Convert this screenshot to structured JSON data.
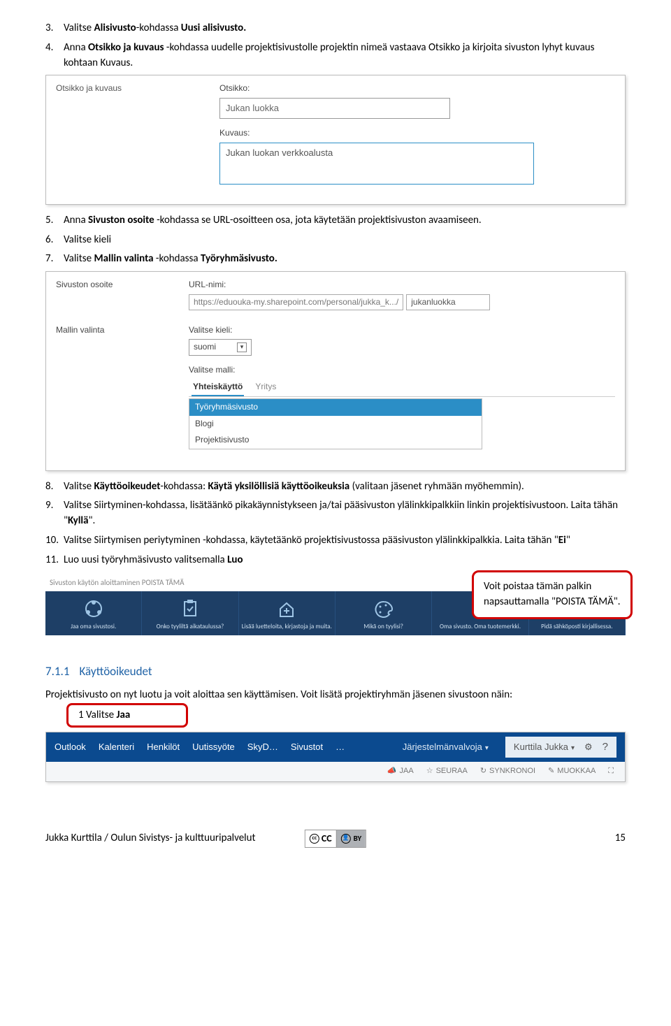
{
  "steps": {
    "s3": {
      "num": "3.",
      "p1": "Valitse ",
      "b1": "Alisivusto",
      "p2": "-kohdassa ",
      "b2": "Uusi alisivusto."
    },
    "s4": {
      "num": "4.",
      "p1": "Anna ",
      "b1": "Otsikko ja kuvaus",
      "p2": " -kohdassa uudelle projektisivustolle projektin nimeä vastaava Otsikko ja kirjoita sivuston lyhyt kuvaus kohtaan Kuvaus."
    },
    "s5": {
      "num": "5.",
      "p1": "Anna ",
      "b1": "Sivuston osoite",
      "p2": " -kohdassa se URL-osoitteen osa, jota käytetään projektisivuston avaamiseen."
    },
    "s6": {
      "num": "6.",
      "p1": "Valitse kieli"
    },
    "s7": {
      "num": "7.",
      "p1": "Valitse ",
      "b1": "Mallin valinta",
      "p2": " -kohdassa ",
      "b2": "Työryhmäsivusto."
    },
    "s8": {
      "num": "8.",
      "p1": "Valitse ",
      "b1": "Käyttöoikeudet",
      "p2": "-kohdassa: ",
      "b2": "Käytä yksilöllisiä käyttöoikeuksia",
      "p3": " (valitaan jäsenet ryhmään myöhemmin)."
    },
    "s9": {
      "num": "9.",
      "p1": "Valitse Siirtyminen-kohdassa, lisätäänkö pikakäynnistykseen ja/tai pääsivuston ylälinkkipalkkiin linkin projektisivustoon. Laita tähän \"",
      "b1": "Kyllä",
      "p2": "\"."
    },
    "s10": {
      "num": "10.",
      "p1": "Valitse Siirtymisen periytyminen -kohdassa, käytetäänkö projektisivustossa pääsivuston ylälinkkipalkkia. Laita tähän \"",
      "b1": "Ei",
      "p2": "\""
    },
    "s11": {
      "num": "11.",
      "p1": "Luo uusi työryhmäsivusto valitsemalla ",
      "b1": "Luo"
    }
  },
  "sc1": {
    "panel_label": "Otsikko ja kuvaus",
    "otsikko_label": "Otsikko:",
    "otsikko_value": "Jukan luokka",
    "kuvaus_label": "Kuvaus:",
    "kuvaus_value": "Jukan luokan verkkoalusta"
  },
  "sc2": {
    "site_label": "Sivuston osoite",
    "url_label": "URL-nimi:",
    "url_prefix": "https://eduouka-my.sharepoint.com/personal/jukka_k.../",
    "url_value": "jukanluokka",
    "template_label": "Mallin valinta",
    "lang_label": "Valitse kieli:",
    "lang_value": "suomi",
    "tmpl_label": "Valitse malli:",
    "tab1": "Yhteiskäyttö",
    "tab2": "Yritys",
    "t1": "Työryhmäsivusto",
    "t2": "Blogi",
    "t3": "Projektisivusto"
  },
  "tilebar": {
    "header": "Sivuston käytön aloittaminen    POISTA TÄMÄ",
    "tiles": [
      {
        "label": "Jaa oma sivustosi."
      },
      {
        "label": "Onko tyyliltä aikataulussa?"
      },
      {
        "label": "Lisää luetteloita, kirjastoja ja muita."
      },
      {
        "label": "Mikä on tyylisi?"
      },
      {
        "label": "Oma sivusto. Oma tuotemerkki."
      },
      {
        "label": "Pidä sähköposti kirjallisessa."
      }
    ]
  },
  "callout1": "Voit poistaa tämän palkin napsauttamalla \"POISTA TÄMÄ\".",
  "sect": {
    "num": "7.1.1",
    "title": "Käyttöoikeudet"
  },
  "para2": "Projektisivusto on nyt luotu ja voit aloittaa sen käyttämisen. Voit lisätä projektiryhmän jäsenen sivustoon näin:",
  "valitse_jaa": {
    "pre": "1 Valitse ",
    "b": "Jaa"
  },
  "toolbar": {
    "items": [
      "Outlook",
      "Kalenteri",
      "Henkilöt",
      "Uutissyöte",
      "SkyD…",
      "Sivustot",
      "…"
    ],
    "admin": "Järjestelmänvalvoja",
    "user": "Kurttila Jukka",
    "actions": [
      "JAA",
      "SEURAA",
      "SYNKRONOI",
      "MUOKKAA"
    ]
  },
  "footer": {
    "left": "Jukka Kurttila / Oulun Sivistys- ja kulttuuripalvelut",
    "cc": "CC",
    "by": "BY",
    "page": "15"
  }
}
